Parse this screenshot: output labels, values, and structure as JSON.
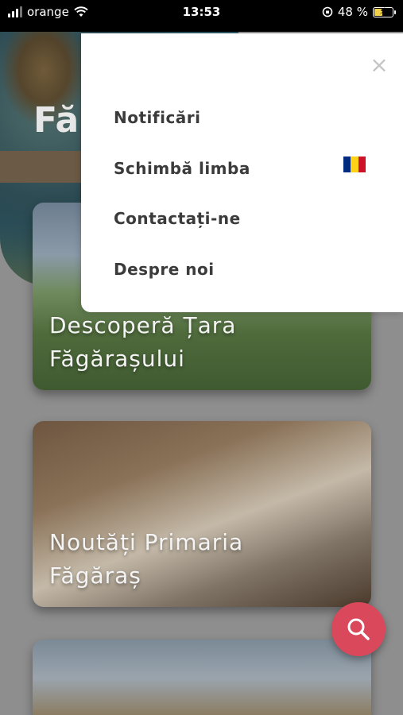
{
  "status_bar": {
    "carrier": "orange",
    "time": "13:53",
    "battery_percent": "48 %",
    "battery_level": 0.48
  },
  "hero": {
    "title": "Fă"
  },
  "cards": [
    {
      "title_line1": "Descoperă Țara",
      "title_line2": "Făgărașului"
    },
    {
      "title_line1": "Noutăți Primaria",
      "title_line2": "Făgăraș"
    },
    {
      "title_line1": "",
      "title_line2": ""
    }
  ],
  "menu": {
    "items": [
      {
        "label": "Notificări"
      },
      {
        "label": "Schimbă limba",
        "flag": "romania-flag",
        "flag_colors": [
          "#002b7f",
          "#fcd116",
          "#ce1126"
        ]
      },
      {
        "label": "Contactați-ne"
      },
      {
        "label": "Despre noi"
      }
    ],
    "close_icon": "close-icon"
  },
  "fab": {
    "icon": "search-icon",
    "color": "#d9485b"
  }
}
